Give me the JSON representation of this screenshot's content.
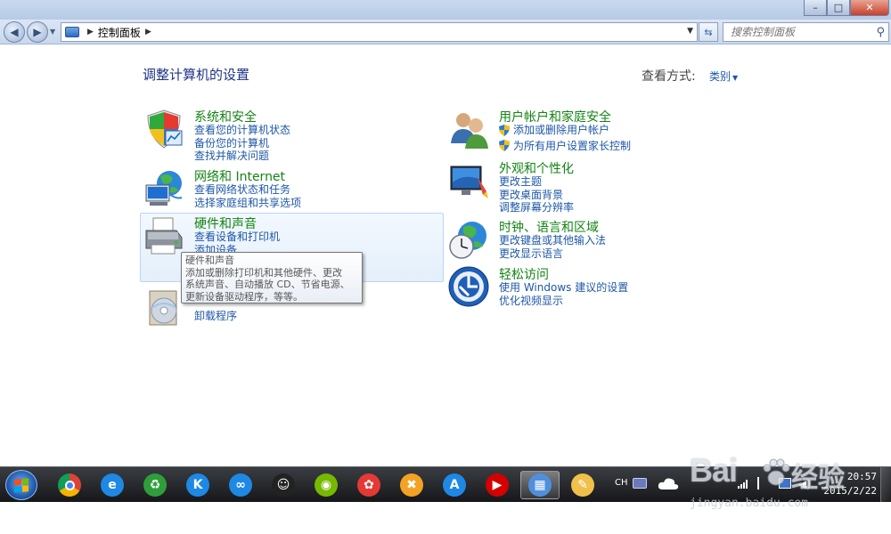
{
  "window": {
    "controls": {
      "minimize": "–",
      "maximize": "□",
      "close": "✕"
    }
  },
  "nav": {
    "back": "◀",
    "forward": "▶",
    "path": [
      "控制面板"
    ],
    "search_placeholder": "搜索控制面板"
  },
  "header": {
    "title": "调整计算机的设置",
    "view_by_label": "查看方式:",
    "view_by_value": "类别"
  },
  "categories": {
    "system": {
      "title": "系统和安全",
      "links": [
        "查看您的计算机状态",
        "备份您的计算机",
        "查找并解决问题"
      ]
    },
    "network": {
      "title": "网络和 Internet",
      "links": [
        "查看网络状态和任务",
        "选择家庭组和共享选项"
      ]
    },
    "hardware": {
      "title": "硬件和声音",
      "links": [
        "查看设备和打印机",
        "添加设备"
      ]
    },
    "programs": {
      "links": [
        "卸载程序"
      ]
    },
    "users": {
      "title": "用户帐户和家庭安全",
      "links": [
        "添加或删除用户帐户",
        "为所有用户设置家长控制"
      ]
    },
    "appearance": {
      "title": "外观和个性化",
      "links": [
        "更改主题",
        "更改桌面背景",
        "调整屏幕分辨率"
      ]
    },
    "clock": {
      "title": "时钟、语言和区域",
      "links": [
        "更改键盘或其他输入法",
        "更改显示语言"
      ]
    },
    "access": {
      "title": "轻松访问",
      "links": [
        "使用 Windows 建议的设置",
        "优化视频显示"
      ]
    }
  },
  "tooltip": {
    "lines": [
      "硬件和声音",
      "添加或删除打印机和其他硬件、更改",
      "系统声音、自动播放 CD、节省电源、",
      "更新设备驱动程序，等等。"
    ]
  },
  "taskbar": {
    "apps": [
      {
        "icon": "chrome-icon",
        "color": "#db4437"
      },
      {
        "icon": "ie-icon",
        "color": "#1e88e5",
        "glyph": "e"
      },
      {
        "icon": "recycle-icon",
        "color": "#2e9e3a",
        "glyph": "♻"
      },
      {
        "icon": "k-app-icon",
        "color": "#1e88e5",
        "glyph": "K"
      },
      {
        "icon": "link-app-icon",
        "color": "#1e88e5",
        "glyph": "∞"
      },
      {
        "icon": "qq-icon",
        "color": "#222222",
        "glyph": "☺"
      },
      {
        "icon": "nvidia-icon",
        "color": "#76b900",
        "glyph": "◉"
      },
      {
        "icon": "colorful-app-icon",
        "color": "#e53935",
        "glyph": "✿"
      },
      {
        "icon": "tools-icon",
        "color": "#f4a223",
        "glyph": "✖"
      },
      {
        "icon": "shield-app-icon",
        "color": "#1e88e5",
        "glyph": "A"
      },
      {
        "icon": "player-icon",
        "color": "#d50000",
        "glyph": "▶"
      },
      {
        "icon": "control-panel-icon",
        "color": "#4f8fdb",
        "glyph": "▦"
      },
      {
        "icon": "paint-icon",
        "color": "#f0c04a",
        "glyph": "✎"
      }
    ],
    "active_index": 11,
    "lang": "CH",
    "time": "20:57",
    "date": "2015/2/22"
  },
  "watermark": {
    "brand": "Bai",
    "text": "经验",
    "url": "jingyan.baidu.com"
  },
  "colors": {
    "link": "#1e57a8",
    "category_title": "#138313",
    "page_title": "#1e3287"
  }
}
